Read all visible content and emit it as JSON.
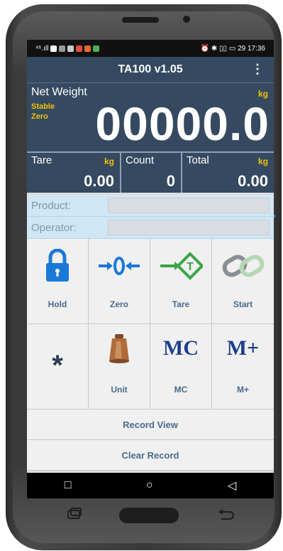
{
  "status_bar": {
    "left_text": "⁴⁶.ıll",
    "right_icons": "⏰ ✱ ▯▯ ▭",
    "battery": "29",
    "time": "17:36"
  },
  "app": {
    "title": "TA100 v1.05",
    "menu_icon": "kebab-menu-icon"
  },
  "weight": {
    "label": "Net Weight",
    "unit": "kg",
    "stable": "Stable",
    "zero": "Zero",
    "value": "00000.0"
  },
  "tare": {
    "label": "Tare",
    "unit": "kg",
    "value": "0.00"
  },
  "count": {
    "label": "Count",
    "value": "0"
  },
  "total": {
    "label": "Total",
    "unit": "kg",
    "value": "0.00"
  },
  "fields": {
    "product_label": "Product:",
    "operator_label": "Operator:",
    "product_value": "",
    "operator_value": ""
  },
  "buttons": {
    "hold": "Hold",
    "zero": "Zero",
    "tare": "Tare",
    "start": "Start",
    "star_symbol": "*",
    "unit": "Unit",
    "mc_icon_text": "MC",
    "mc": "MC",
    "mplus_icon_text": "M+",
    "mplus": "M+",
    "record_view": "Record View",
    "clear_record": "Clear Record"
  },
  "nav": {
    "recents": "□",
    "home": "○",
    "back": "◁"
  },
  "colors": {
    "header": "#354a60",
    "accent_yellow": "#f2c200",
    "label_blue": "#4a6a8e",
    "field_bg": "#cfe6f5"
  }
}
